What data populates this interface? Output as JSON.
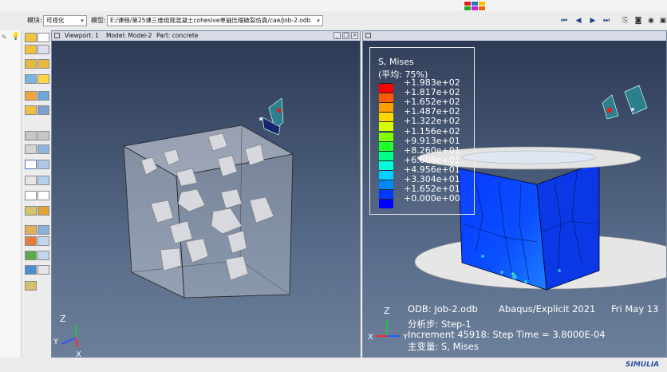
{
  "toolbar": {
    "module_label": "模块:",
    "module_value": "可视化",
    "model_label": "模型:",
    "model_path": "E:/课程/第25课三维组观混凝土cohesive单轴压缩破裂仿真/cae/Job-2.odb"
  },
  "viewport1": {
    "name": "Viewport: 1",
    "model": "Model: Model-2",
    "part": "Part: concrete"
  },
  "legend": {
    "title": "S, Mises",
    "subtitle": "(平均: 75%)",
    "values": [
      "+1.983e+02",
      "+1.817e+02",
      "+1.652e+02",
      "+1.487e+02",
      "+1.322e+02",
      "+1.156e+02",
      "+9.913e+01",
      "+8.260e+01",
      "+6.608e+01",
      "+4.956e+01",
      "+3.304e+01",
      "+1.652e+01",
      "+0.000e+00"
    ],
    "colors": [
      "#ff0000",
      "#ff5a00",
      "#ffa000",
      "#ffd800",
      "#d6ff00",
      "#7fff00",
      "#1fff2a",
      "#00ff88",
      "#00ffd8",
      "#00cfff",
      "#0088ff",
      "#0038ff",
      "#0000ff"
    ]
  },
  "odb_info": {
    "line1_left": "ODB: Job-2.odb",
    "line1_mid": "Abaqus/Explicit 2021",
    "line1_right": "Fri May 13",
    "step": "分析步: Step-1",
    "increment": "Increment     45918: Step Time =    3.8000E-04",
    "variable": "主变量: S, Mises"
  },
  "triad": {
    "x": "X",
    "y": "Y",
    "z": "Z"
  },
  "brand": "SIMULIA",
  "colors": {
    "viewport_top": "#2c3a55",
    "viewport_bottom": "#6c7f9a",
    "title_bar": "#d6dbe6"
  }
}
